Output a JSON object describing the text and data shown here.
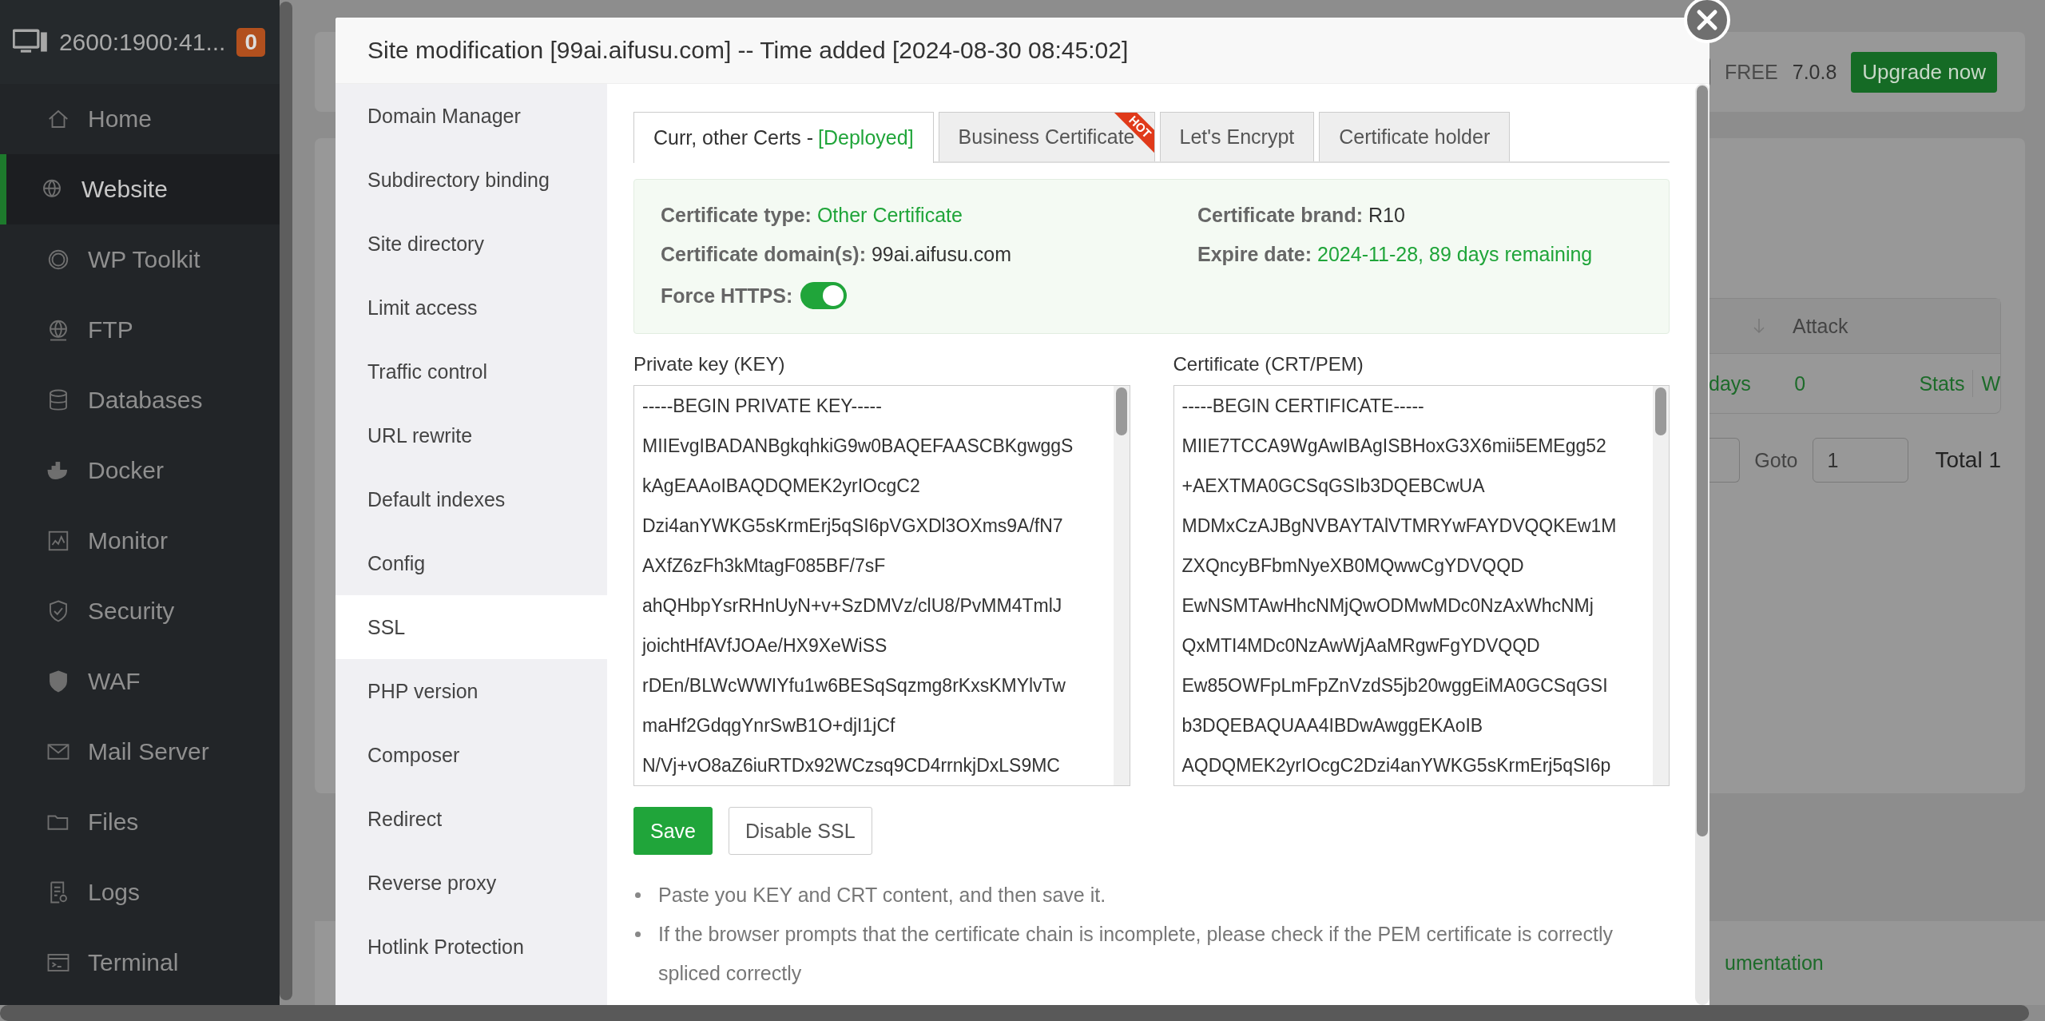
{
  "sidebar": {
    "host": "2600:1900:41...",
    "badge": "0",
    "items": [
      {
        "label": "Home",
        "selected": false
      },
      {
        "label": "Website",
        "selected": true
      },
      {
        "label": "WP Toolkit",
        "selected": false
      },
      {
        "label": "FTP",
        "selected": false
      },
      {
        "label": "Databases",
        "selected": false
      },
      {
        "label": "Docker",
        "selected": false
      },
      {
        "label": "Monitor",
        "selected": false
      },
      {
        "label": "Security",
        "selected": false
      },
      {
        "label": "WAF",
        "selected": false
      },
      {
        "label": "Mail Server",
        "selected": false
      },
      {
        "label": "Files",
        "selected": false
      },
      {
        "label": "Logs",
        "selected": false
      },
      {
        "label": "Terminal",
        "selected": false
      }
    ]
  },
  "background": {
    "plan": "FREE",
    "version": "7.0.8",
    "upgrade": "Upgrade now",
    "table_header": "Attack",
    "row": {
      "period": "days",
      "attacks": "0",
      "actions": [
        "Stats",
        "W"
      ]
    },
    "pagination": {
      "goto_label": "Goto",
      "page": "1",
      "total": "Total 1"
    },
    "footer_link": "umentation"
  },
  "modal": {
    "title": "Site modification [99ai.aifusu.com] -- Time added [2024-08-30 08:45:02]",
    "nav": [
      {
        "label": "Domain Manager",
        "selected": false
      },
      {
        "label": "Subdirectory binding",
        "selected": false
      },
      {
        "label": "Site directory",
        "selected": false
      },
      {
        "label": "Limit access",
        "selected": false
      },
      {
        "label": "Traffic control",
        "selected": false
      },
      {
        "label": "URL rewrite",
        "selected": false
      },
      {
        "label": "Default indexes",
        "selected": false
      },
      {
        "label": "Config",
        "selected": false
      },
      {
        "label": "SSL",
        "selected": true
      },
      {
        "label": "PHP version",
        "selected": false
      },
      {
        "label": "Composer",
        "selected": false
      },
      {
        "label": "Redirect",
        "selected": false
      },
      {
        "label": "Reverse proxy",
        "selected": false
      },
      {
        "label": "Hotlink Protection",
        "selected": false
      }
    ],
    "tabs": [
      {
        "label": "Curr, other Certs - ",
        "status": "[Deployed]",
        "selected": true
      },
      {
        "label": "Business Certificate",
        "badge": "HOT",
        "selected": false
      },
      {
        "label": "Let's Encrypt",
        "selected": false
      },
      {
        "label": "Certificate holder",
        "selected": false
      }
    ],
    "cert_info": {
      "type_label": "Certificate type:",
      "type_value": "Other Certificate",
      "brand_label": "Certificate brand:",
      "brand_value": "R10",
      "domain_label": "Certificate domain(s):",
      "domain_value": "99ai.aifusu.com",
      "expire_label": "Expire date:",
      "expire_value": "2024-11-28, 89 days remaining",
      "force_https_label": "Force HTTPS:",
      "force_https_on": true
    },
    "key": {
      "label": "Private key (KEY)",
      "lines": [
        "-----BEGIN PRIVATE KEY-----",
        "MIIEvgIBADANBgkqhkiG9w0BAQEFAASCBKgwggS",
        "kAgEAAoIBAQDQMEK2yrIOcgC2",
        "Dzi4anYWKG5sKrmErj5qSI6pVGXDl3OXms9A/fN7",
        "AXfZ6zFh3kMtagF085BF/7sF",
        "ahQHbpYsrRHnUyN+v+SzDMVz/clU8/PvMM4TmlJ",
        "joichtHfAVfJOAe/HX9XeWiSS",
        "rDEn/BLWcWWIYfu1w6BESqSqzmg8rKxsKMYlvTw",
        "maHf2GdqgYnrSwB1O+djI1jCf",
        "N/Vj+vO8aZ6iuRTDx92WCzsq9CD4rrnkjDxLS9MC"
      ]
    },
    "cert": {
      "label": "Certificate (CRT/PEM)",
      "lines": [
        "-----BEGIN CERTIFICATE-----",
        "MIIE7TCCA9WgAwIBAgISBHoxG3X6mii5EMEgg52",
        "+AEXTMA0GCSqGSIb3DQEBCwUA",
        "MDMxCzAJBgNVBAYTAlVTMRYwFAYDVQQKEw1M",
        "ZXQncyBFbmNyeXB0MQwwCgYDVQQD",
        "EwNSMTAwHhcNMjQwODMwMDc0NzAxWhcNMj",
        "QxMTI4MDc0NzAwWjAaMRgwFgYDVQQD",
        "Ew85OWFpLmFpZnVzdS5jb20wggEiMA0GCSqGSI",
        "b3DQEBAQUAA4IBDwAwggEKAoIB",
        "AQDQMEK2yrIOcgC2Dzi4anYWKG5sKrmErj5qSI6p"
      ]
    },
    "buttons": [
      {
        "label": "Save",
        "kind": "primary"
      },
      {
        "label": "Disable SSL",
        "kind": "default"
      }
    ],
    "notes": [
      "Paste you KEY and CRT content, and then save it.",
      "If the browser prompts that the certificate chain is incomplete, please check if the PEM certificate is correctly spliced correctly"
    ]
  }
}
